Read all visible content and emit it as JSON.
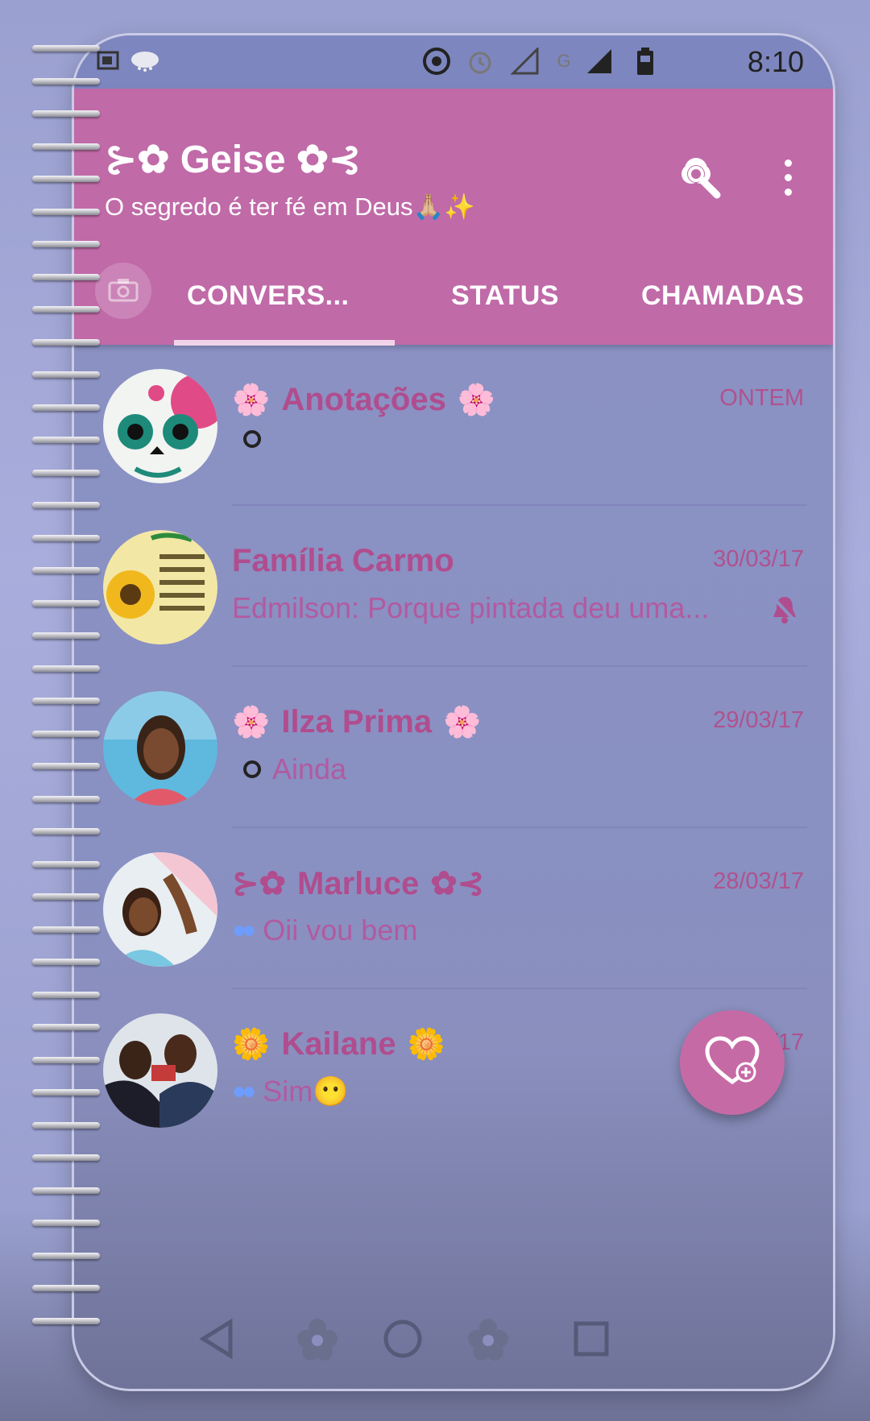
{
  "status_bar": {
    "time": "8:10",
    "icons": [
      "cloud-icon",
      "screenshot-icon",
      "target-icon",
      "alarm-icon",
      "signal-empty-icon",
      "network-g-icon",
      "signal-full-icon",
      "battery-icon"
    ]
  },
  "header": {
    "title": "⊱✿ Geise ✿⊰",
    "subtitle": "O segredo é ter fé em Deus🙏🏼✨",
    "background": "#c06aa8"
  },
  "tabs": [
    {
      "label": "CONVERS..."
    },
    {
      "label": "STATUS"
    },
    {
      "label": "CHAMADAS"
    }
  ],
  "chats": [
    {
      "name": "Anotações",
      "time": "ONTEM",
      "message": ""
    },
    {
      "name": "Família Carmo",
      "time": "30/03/17",
      "message": "Edmilson: Porque pintada deu uma..."
    },
    {
      "name": "Ilza Prima",
      "time": "29/03/17",
      "message": "Ainda"
    },
    {
      "name": "Marluce",
      "time": "28/03/17",
      "message": "Oii vou bem"
    },
    {
      "name": "Kailane",
      "time": "16/03/17",
      "message": "Sim😶"
    }
  ],
  "deco": {
    "flower": "🌸",
    "sun": "🌼",
    "left_flourish": "⊱✿",
    "right_flourish": "✿⊰"
  },
  "colors": {
    "accent": "#c06aa8",
    "name_text": "#b04d8e",
    "list_background": "#8c92c4",
    "read_ticks": "#6e9cff"
  }
}
